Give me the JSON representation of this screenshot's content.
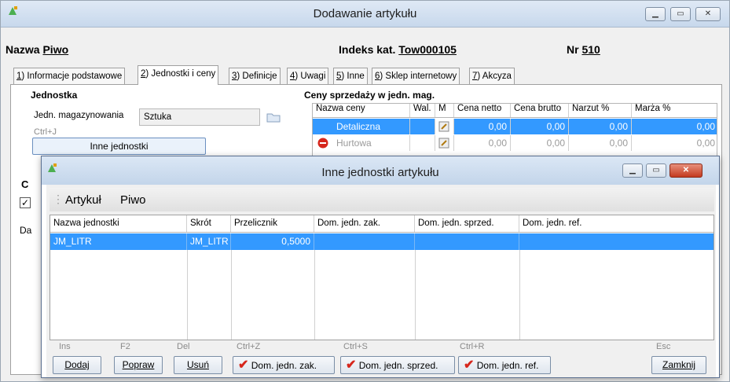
{
  "outer": {
    "title": "Dodawanie artykułu",
    "name_label": "Nazwa",
    "name_value": "Piwo",
    "index_label": "Indeks kat.",
    "index_value": "Tow000105",
    "nr_label": "Nr",
    "nr_value": "510",
    "tabs": [
      {
        "key": "1",
        "text": ") Informacje podstawowe"
      },
      {
        "key": "2",
        "text": ") Jednostki i ceny"
      },
      {
        "key": "3",
        "text": ") Definicje"
      },
      {
        "key": "4",
        "text": ") Uwagi"
      },
      {
        "key": "5",
        "text": ") Inne"
      },
      {
        "key": "6",
        "text": ") Sklep internetowy"
      },
      {
        "key": "7",
        "text": ") Akcyza"
      }
    ],
    "unit_group": "Jednostka",
    "unit_label": "Jedn. magazynowania",
    "unit_value": "Sztuka",
    "ctrl_hint": "Ctrl+J",
    "other_units_button": "Inne jednostki",
    "prices_group": "Ceny sprzedaży w jedn. mag.",
    "price_headers": [
      "Nazwa ceny",
      "Wal.",
      "M",
      "Cena netto",
      "Cena brutto",
      "Narzut %",
      "Marża %"
    ],
    "price_rows": [
      {
        "name": "Detaliczna",
        "netto": "0,00",
        "brutto": "0,00",
        "narzut": "0,00",
        "marza": "0,00"
      },
      {
        "name": "Hurtowa",
        "netto": "0,00",
        "brutto": "0,00",
        "narzut": "0,00",
        "marza": "0,00"
      }
    ],
    "cut_labels": {
      "c": "C",
      "d": "Da"
    }
  },
  "dialog": {
    "title": "Inne jednostki artykułu",
    "article_label": "Artykuł",
    "article_value": "Piwo",
    "headers": [
      "Nazwa jednostki",
      "Skrót",
      "Przelicznik",
      "Dom. jedn. zak.",
      "Dom. jedn. sprzed.",
      "Dom. jedn. ref."
    ],
    "rows": [
      {
        "name": "JM_LITR",
        "short": "JM_LITR",
        "factor": "0,5000",
        "zak": "",
        "sprzed": "",
        "ref": ""
      }
    ],
    "hints": [
      "Ins",
      "F2",
      "Del",
      "Ctrl+Z",
      "Ctrl+S",
      "Ctrl+R",
      "Esc"
    ],
    "buttons": {
      "add": "Dodaj",
      "edit": "Popraw",
      "delete": "Usuń",
      "dom_zak": "Dom. jedn. zak.",
      "dom_sprzed": "Dom. jedn. sprzed.",
      "dom_ref": "Dom. jedn. ref.",
      "close": "Zamknij"
    }
  }
}
